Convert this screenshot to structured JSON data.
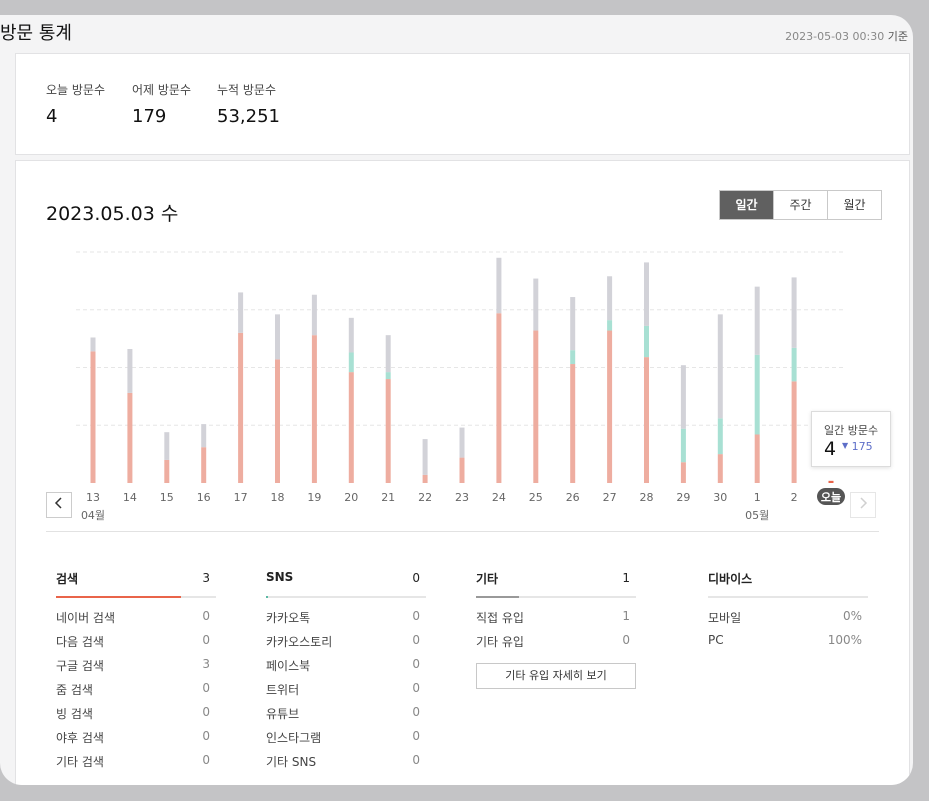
{
  "header": {
    "title": "방문 통계",
    "timestamp": "2023-05-03 00:30",
    "timestamp_suffix": "기준"
  },
  "summary": {
    "today": {
      "label": "오늘 방문수",
      "value": "4"
    },
    "yesterday": {
      "label": "어제 방문수",
      "value": "179"
    },
    "total": {
      "label": "누적 방문수",
      "value": "53,251"
    }
  },
  "main": {
    "date_title": "2023.05.03 수",
    "periods": [
      {
        "label": "일간",
        "active": true
      },
      {
        "label": "주간",
        "active": false
      },
      {
        "label": "월간",
        "active": false
      }
    ],
    "nav": {
      "prev_icon": "chevron-left-icon",
      "next_icon": "chevron-right-icon"
    }
  },
  "chart_data": {
    "type": "bar",
    "stacked": true,
    "grid": true,
    "ylim": [
      0,
      200
    ],
    "categories": [
      "13",
      "14",
      "15",
      "16",
      "17",
      "18",
      "19",
      "20",
      "21",
      "22",
      "23",
      "24",
      "25",
      "26",
      "27",
      "28",
      "29",
      "30",
      "1",
      "2",
      "오늘"
    ],
    "month_labels": [
      {
        "index": 0,
        "label": "04월"
      },
      {
        "index": 18,
        "label": "05월"
      }
    ],
    "today_label": "오늘",
    "series": [
      {
        "color": "#eeada0",
        "values": [
          114,
          78,
          20,
          31,
          130,
          107,
          128,
          96,
          90,
          7,
          22,
          147,
          132,
          103,
          132,
          109,
          18,
          25,
          42,
          88,
          2
        ]
      },
      {
        "color": "#a8e0d3",
        "values": [
          0,
          0,
          0,
          0,
          0,
          0,
          0,
          17,
          6,
          0,
          0,
          0,
          0,
          12,
          9,
          27,
          29,
          31,
          69,
          29,
          0
        ]
      },
      {
        "color": "#d2d2d8",
        "values": [
          12,
          38,
          24,
          20,
          35,
          39,
          35,
          30,
          32,
          31,
          26,
          48,
          45,
          46,
          38,
          55,
          55,
          90,
          59,
          61,
          0
        ]
      }
    ],
    "colors": {
      "grid": "#e6e6e6",
      "axis_text": "#666",
      "today_badge": "#555",
      "today_marker": "#e9644a"
    }
  },
  "tooltip": {
    "label": "일간 방문수",
    "value": "4",
    "delta_icon": "triangle-down-icon",
    "delta": "175"
  },
  "stats": {
    "search": {
      "title": "검색",
      "count": "3",
      "accent": "#e9644a",
      "fill": 0.78,
      "rows": [
        {
          "label": "네이버 검색",
          "value": "0"
        },
        {
          "label": "다음 검색",
          "value": "0"
        },
        {
          "label": "구글 검색",
          "value": "3"
        },
        {
          "label": "줌 검색",
          "value": "0"
        },
        {
          "label": "빙 검색",
          "value": "0"
        },
        {
          "label": "야후 검색",
          "value": "0"
        },
        {
          "label": "기타 검색",
          "value": "0"
        }
      ]
    },
    "sns": {
      "title": "SNS",
      "count": "0",
      "accent": "#5ab9a4",
      "fill": 0.01,
      "rows": [
        {
          "label": "카카오톡",
          "value": "0"
        },
        {
          "label": "카카오스토리",
          "value": "0"
        },
        {
          "label": "페이스북",
          "value": "0"
        },
        {
          "label": "트위터",
          "value": "0"
        },
        {
          "label": "유튜브",
          "value": "0"
        },
        {
          "label": "인스타그램",
          "value": "0"
        },
        {
          "label": "기타 SNS",
          "value": "0"
        }
      ]
    },
    "etc": {
      "title": "기타",
      "count": "1",
      "accent": "#999999",
      "fill": 0.27,
      "rows": [
        {
          "label": "직접 유입",
          "value": "1"
        },
        {
          "label": "기타 유입",
          "value": "0"
        }
      ],
      "detail_button": "기타 유입 자세히 보기"
    },
    "device": {
      "title": "디바이스",
      "rows": [
        {
          "label": "모바일",
          "value": "0%"
        },
        {
          "label": "PC",
          "value": "100%"
        }
      ]
    }
  }
}
